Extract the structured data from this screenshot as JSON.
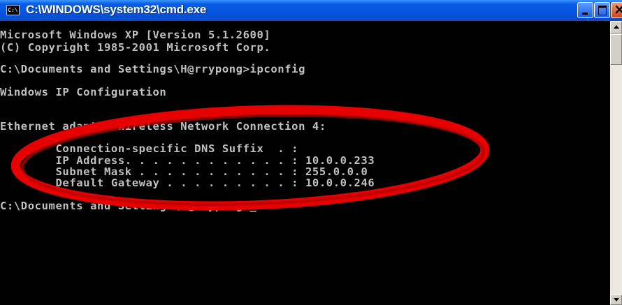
{
  "window": {
    "title": "C:\\WINDOWS\\system32\\cmd.exe",
    "icon_label": "C:\\",
    "icon": "console-icon",
    "buttons": [
      "minimize-icon",
      "maximize-icon",
      "close-icon"
    ]
  },
  "console": {
    "lines": [
      "Microsoft Windows XP [Version 5.1.2600]",
      "(C) Copyright 1985-2001 Microsoft Corp.",
      "",
      "C:\\Documents and Settings\\H@rrypong>ipconfig",
      "",
      "Windows IP Configuration",
      "",
      "",
      "Ethernet adapter Wireless Network Connection 4:",
      "",
      "        Connection-specific DNS Suffix  . :",
      "        IP Address. . . . . . . . . . . . : 10.0.0.233",
      "        Subnet Mask . . . . . . . . . . . : 255.0.0.0",
      "        Default Gateway . . . . . . . . . : 10.0.0.246",
      "",
      "C:\\Documents and Settings\\H@rrypong>_"
    ]
  },
  "annotation": {
    "color": "#e60000",
    "shape": "ellipse"
  },
  "colors": {
    "console_bg": "#000000",
    "console_fg": "#c0c0c0",
    "titlebar": "#0554e0"
  }
}
